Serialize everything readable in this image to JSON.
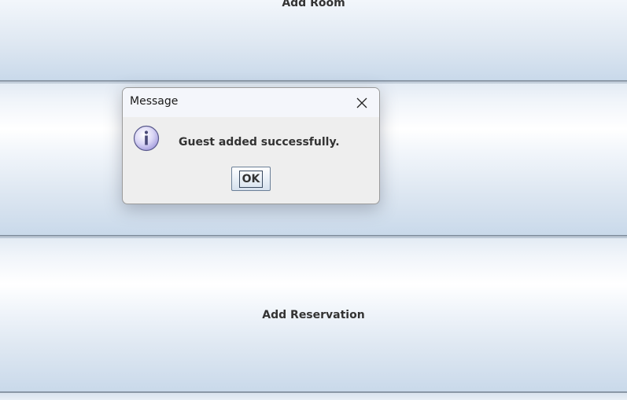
{
  "main": {
    "buttons": [
      {
        "label": "Add Room"
      },
      {
        "label": ""
      },
      {
        "label": "Add Reservation"
      }
    ]
  },
  "dialog": {
    "title": "Message",
    "message": "Guest added successfully.",
    "ok_label": "OK",
    "icons": {
      "type": "info-icon",
      "close": "close-icon"
    }
  }
}
